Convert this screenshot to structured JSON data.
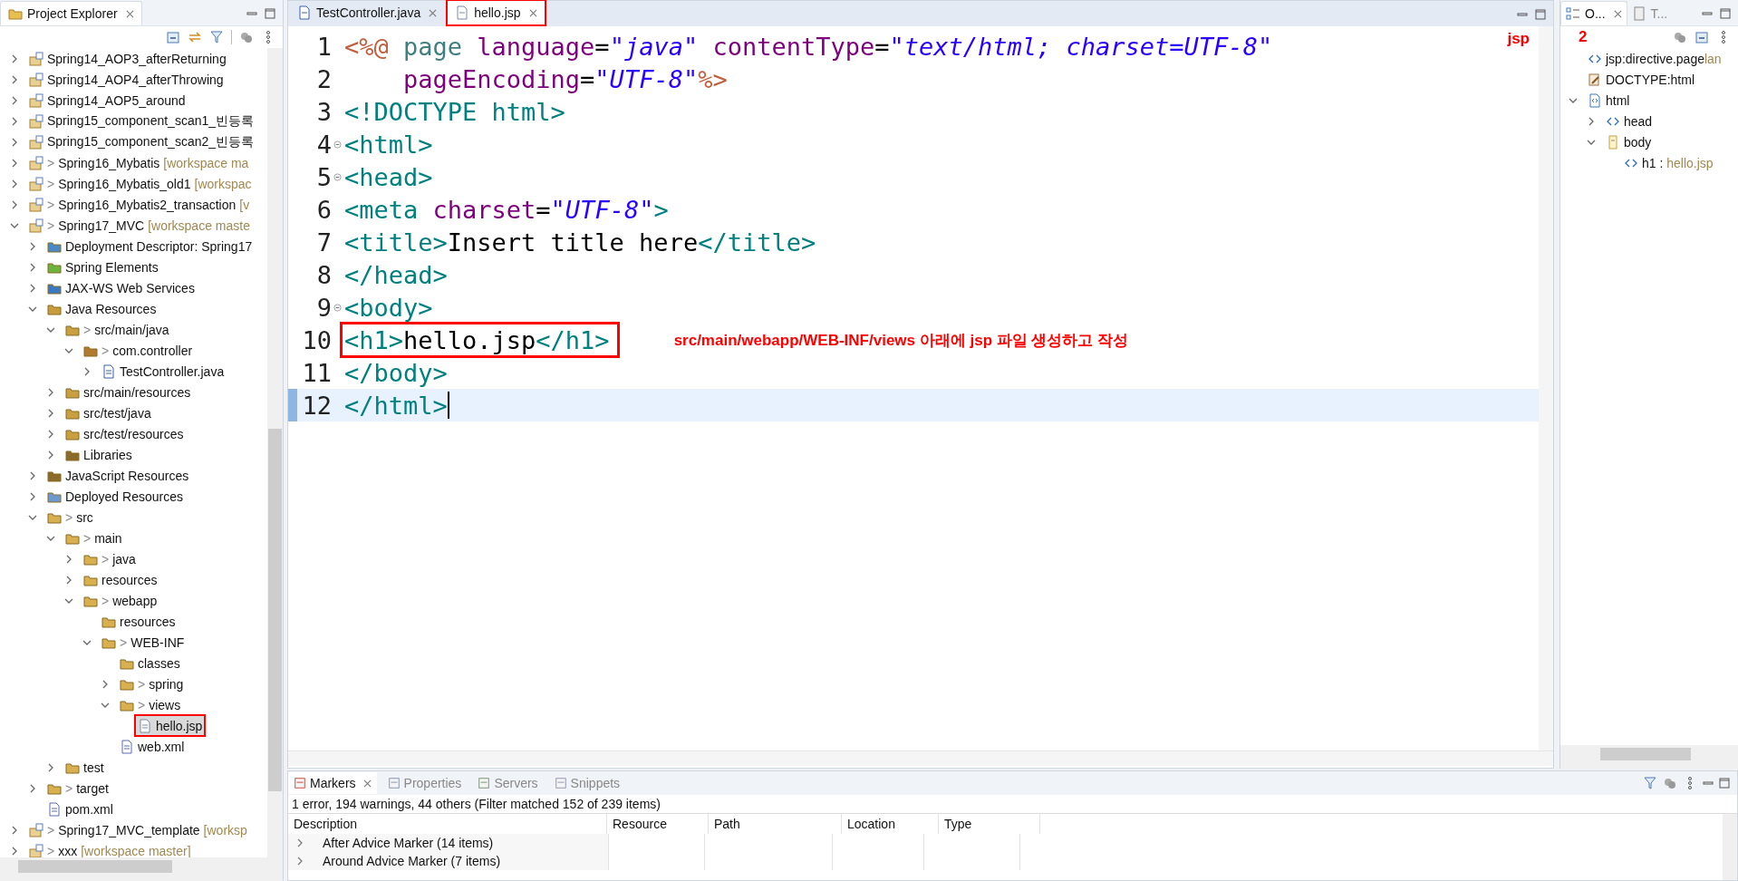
{
  "project_explorer": {
    "title": "Project Explorer",
    "tree": [
      {
        "label": "Spring14_AOP3_afterReturning",
        "kind": "project",
        "expanded": false,
        "selected": false,
        "annotated": false
      },
      {
        "label": "Spring14_AOP4_afterThrowing",
        "kind": "project",
        "expanded": false,
        "selected": false,
        "annotated": false
      },
      {
        "label": "Spring14_AOP5_around",
        "kind": "project",
        "expanded": false,
        "selected": false,
        "annotated": false
      },
      {
        "label": "Spring15_component_scan1_빈등록",
        "kind": "project",
        "expanded": false,
        "selected": false,
        "annotated": false
      },
      {
        "label": "Spring15_component_scan2_빈등록",
        "kind": "project",
        "expanded": false,
        "selected": false,
        "annotated": false
      },
      {
        "label": "Spring16_Mybatis",
        "prefix": ">",
        "decoration": "[workspace ma",
        "kind": "project",
        "expanded": false,
        "selected": false,
        "annotated": false
      },
      {
        "label": "Spring16_Mybatis_old1",
        "prefix": ">",
        "decoration": "[workspac",
        "kind": "project",
        "expanded": false,
        "selected": false,
        "annotated": false
      },
      {
        "label": "Spring16_Mybatis2_transaction",
        "prefix": ">",
        "decoration": "[v",
        "kind": "project",
        "expanded": false,
        "selected": false,
        "annotated": false
      },
      {
        "label": "Spring17_MVC",
        "prefix": ">",
        "decoration": "[workspace maste",
        "kind": "project",
        "expanded": true,
        "selected": false,
        "annotated": false,
        "children": [
          {
            "label": "Deployment Descriptor: Spring17",
            "kind": "descriptor",
            "expanded": false,
            "selected": false,
            "annotated": false
          },
          {
            "label": "Spring Elements",
            "kind": "spring",
            "expanded": false,
            "selected": false,
            "annotated": false
          },
          {
            "label": "JAX-WS Web Services",
            "kind": "webservice",
            "expanded": false,
            "selected": false,
            "annotated": false
          },
          {
            "label": "Java Resources",
            "kind": "resources",
            "expanded": true,
            "selected": false,
            "annotated": false,
            "children": [
              {
                "label": "src/main/java",
                "prefix": ">",
                "kind": "source-folder",
                "expanded": true,
                "selected": false,
                "annotated": false,
                "children": [
                  {
                    "label": "com.controller",
                    "prefix": ">",
                    "kind": "package",
                    "expanded": true,
                    "selected": false,
                    "annotated": false,
                    "children": [
                      {
                        "label": "TestController.java",
                        "kind": "java-file",
                        "expanded": false,
                        "selected": false,
                        "annotated": false
                      }
                    ]
                  }
                ]
              },
              {
                "label": "src/main/resources",
                "kind": "source-folder",
                "expanded": false,
                "selected": false,
                "annotated": false
              },
              {
                "label": "src/test/java",
                "kind": "source-folder",
                "expanded": false,
                "selected": false,
                "annotated": false
              },
              {
                "label": "src/test/resources",
                "kind": "source-folder",
                "expanded": false,
                "selected": false,
                "annotated": false
              },
              {
                "label": "Libraries",
                "kind": "library",
                "expanded": false,
                "selected": false,
                "annotated": false
              }
            ]
          },
          {
            "label": "JavaScript Resources",
            "kind": "library",
            "expanded": false,
            "selected": false,
            "annotated": false
          },
          {
            "label": "Deployed Resources",
            "kind": "deployed",
            "expanded": false,
            "selected": false,
            "annotated": false
          },
          {
            "label": "src",
            "prefix": ">",
            "kind": "folder",
            "expanded": true,
            "selected": false,
            "annotated": false,
            "children": [
              {
                "label": "main",
                "prefix": ">",
                "kind": "folder",
                "expanded": true,
                "selected": false,
                "annotated": false,
                "children": [
                  {
                    "label": "java",
                    "prefix": ">",
                    "kind": "folder",
                    "expanded": false,
                    "selected": false,
                    "annotated": false
                  },
                  {
                    "label": "resources",
                    "kind": "folder",
                    "expanded": false,
                    "selected": false,
                    "annotated": false
                  },
                  {
                    "label": "webapp",
                    "prefix": ">",
                    "kind": "folder",
                    "expanded": true,
                    "selected": false,
                    "annotated": false,
                    "children": [
                      {
                        "label": "resources",
                        "kind": "folder",
                        "selected": false,
                        "annotated": false
                      },
                      {
                        "label": "WEB-INF",
                        "prefix": ">",
                        "kind": "folder",
                        "expanded": true,
                        "selected": false,
                        "annotated": false,
                        "children": [
                          {
                            "label": "classes",
                            "kind": "folder",
                            "selected": false,
                            "annotated": false
                          },
                          {
                            "label": "spring",
                            "prefix": ">",
                            "kind": "folder",
                            "expanded": false,
                            "selected": false,
                            "annotated": false
                          },
                          {
                            "label": "views",
                            "prefix": ">",
                            "kind": "folder",
                            "expanded": true,
                            "selected": false,
                            "annotated": false,
                            "children": [
                              {
                                "label": "hello.jsp",
                                "kind": "jsp-file",
                                "selected": true,
                                "annotated": true
                              }
                            ]
                          },
                          {
                            "label": "web.xml",
                            "kind": "xml-file",
                            "selected": false,
                            "annotated": false
                          }
                        ]
                      }
                    ]
                  }
                ]
              },
              {
                "label": "test",
                "kind": "folder",
                "expanded": false,
                "selected": false,
                "annotated": false
              }
            ]
          },
          {
            "label": "target",
            "prefix": ">",
            "kind": "folder",
            "expanded": false,
            "selected": false,
            "annotated": false
          },
          {
            "label": "pom.xml",
            "kind": "xml-file",
            "selected": false,
            "annotated": false
          }
        ]
      },
      {
        "label": "Spring17_MVC_template",
        "prefix": ">",
        "decoration": "[worksp",
        "kind": "project",
        "expanded": false,
        "selected": false,
        "annotated": false
      },
      {
        "label": "xxx",
        "prefix": ">",
        "decoration": "[workspace master]",
        "kind": "project",
        "expanded": false,
        "selected": false,
        "annotated": false
      }
    ]
  },
  "editor": {
    "tabs": [
      {
        "label": "TestController.java",
        "kind": "java-file",
        "selected": false,
        "annotated": false
      },
      {
        "label": "hello.jsp",
        "kind": "jsp-file",
        "selected": true,
        "annotated": true
      }
    ],
    "corner_note": "jsp",
    "lines": [
      {
        "number": "1",
        "fold": false,
        "current": false,
        "annotated": false,
        "tokens": [
          {
            "kind": "directive",
            "text": "<%@ "
          },
          {
            "kind": "keyword",
            "text": "page "
          },
          {
            "kind": "attr",
            "text": "language"
          },
          {
            "kind": "plain",
            "text": "="
          },
          {
            "kind": "value",
            "text": "\"java\" "
          },
          {
            "kind": "attr",
            "text": "contentType"
          },
          {
            "kind": "plain",
            "text": "="
          },
          {
            "kind": "value",
            "text": "\"text/html; charset=UTF-8\""
          }
        ]
      },
      {
        "number": "2",
        "fold": false,
        "current": false,
        "annotated": false,
        "tokens": [
          {
            "kind": "attr",
            "text": "    pageEncoding"
          },
          {
            "kind": "plain",
            "text": "="
          },
          {
            "kind": "value",
            "text": "\"UTF-8\""
          },
          {
            "kind": "directive",
            "text": "%>"
          }
        ]
      },
      {
        "number": "3",
        "fold": false,
        "current": false,
        "annotated": false,
        "tokens": [
          {
            "kind": "tag",
            "text": "<!DOCTYPE html>"
          }
        ]
      },
      {
        "number": "4",
        "fold": true,
        "current": false,
        "annotated": false,
        "tokens": [
          {
            "kind": "tag",
            "text": "<html>"
          }
        ]
      },
      {
        "number": "5",
        "fold": true,
        "current": false,
        "annotated": false,
        "tokens": [
          {
            "kind": "tag",
            "text": "<head>"
          }
        ]
      },
      {
        "number": "6",
        "fold": false,
        "current": false,
        "annotated": false,
        "tokens": [
          {
            "kind": "tag",
            "text": "<meta "
          },
          {
            "kind": "attr",
            "text": "charset"
          },
          {
            "kind": "plain",
            "text": "="
          },
          {
            "kind": "value",
            "text": "\"UTF-8\""
          },
          {
            "kind": "tag",
            "text": ">"
          }
        ]
      },
      {
        "number": "7",
        "fold": false,
        "current": false,
        "annotated": false,
        "tokens": [
          {
            "kind": "tag",
            "text": "<title>"
          },
          {
            "kind": "plain",
            "text": "Insert title here"
          },
          {
            "kind": "tag",
            "text": "</title>"
          }
        ]
      },
      {
        "number": "8",
        "fold": false,
        "current": false,
        "annotated": false,
        "tokens": [
          {
            "kind": "tag",
            "text": "</head>"
          }
        ]
      },
      {
        "number": "9",
        "fold": true,
        "current": false,
        "annotated": false,
        "tokens": [
          {
            "kind": "tag",
            "text": "<body>"
          }
        ]
      },
      {
        "number": "10",
        "fold": false,
        "current": false,
        "annotated": true,
        "note": "src/main/webapp/WEB-INF/views 아래에 jsp 파일 생성하고 작성",
        "tokens": [
          {
            "kind": "tag",
            "text": "<h1>"
          },
          {
            "kind": "plain",
            "text": "hello.jsp"
          },
          {
            "kind": "tag",
            "text": "</h1>"
          }
        ]
      },
      {
        "number": "11",
        "fold": false,
        "current": false,
        "annotated": false,
        "tokens": [
          {
            "kind": "tag",
            "text": "</body>"
          }
        ]
      },
      {
        "number": "12",
        "fold": false,
        "current": true,
        "annotated": false,
        "tokens": [
          {
            "kind": "tag",
            "text": "</html>"
          }
        ]
      }
    ]
  },
  "outline": {
    "tabs": [
      {
        "label": "O...",
        "kind": "outline",
        "selected": true
      },
      {
        "label": "T...",
        "kind": "task",
        "selected": false
      }
    ],
    "note": "2",
    "tree": [
      {
        "label": "jsp:directive.page",
        "detail": "lan",
        "kind": "element",
        "selected": false
      },
      {
        "label": "DOCTYPE:html",
        "kind": "doctype",
        "selected": false
      },
      {
        "label": "html",
        "kind": "document",
        "expanded": true,
        "selected": false,
        "children": [
          {
            "label": "head",
            "kind": "element",
            "expanded": false,
            "selected": false
          },
          {
            "label": "body",
            "kind": "body",
            "expanded": true,
            "selected": false,
            "children": [
              {
                "label": "h1 : ",
                "detail": "hello.jsp",
                "kind": "element",
                "selected": false
              }
            ]
          }
        ]
      }
    ]
  },
  "bottom_panel": {
    "tabs": [
      {
        "label": "Markers",
        "kind": "markers",
        "selected": true
      },
      {
        "label": "Properties",
        "kind": "properties",
        "selected": false
      },
      {
        "label": "Servers",
        "kind": "servers",
        "selected": false
      },
      {
        "label": "Snippets",
        "kind": "snippets",
        "selected": false
      }
    ],
    "summary": "1 error, 194 warnings, 44 others (Filter matched 152 of 239 items)",
    "columns": [
      "Description",
      "Resource",
      "Path",
      "Location",
      "Type"
    ],
    "rows": [
      {
        "description": "After Advice Marker (14 items)",
        "expanded": false
      },
      {
        "description": "Around Advice Marker (7 items)",
        "expanded": false
      }
    ]
  }
}
